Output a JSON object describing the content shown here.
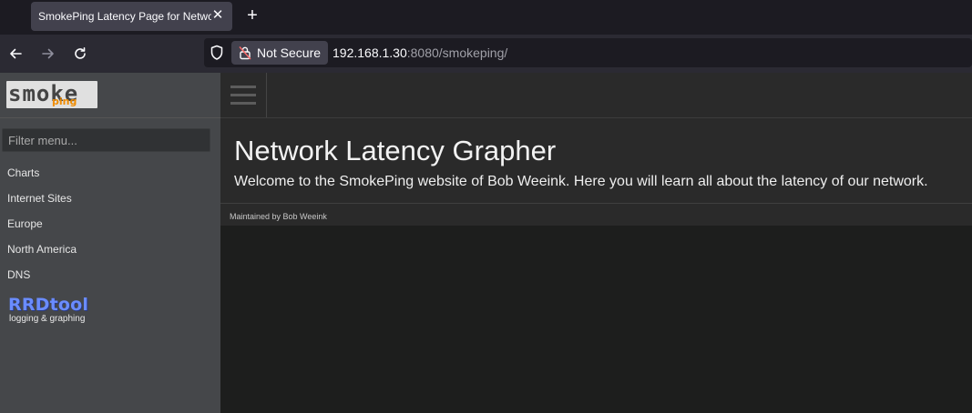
{
  "browser": {
    "tab_title": "SmokePing Latency Page for Network Latency Grapher",
    "tab_close": "✕",
    "new_tab": "+",
    "security_label": "Not Secure",
    "url_host": "192.168.1.30",
    "url_rest": ":8080/smokeping/"
  },
  "sidebar": {
    "logo_main": "smoke",
    "logo_sub": "ping",
    "filter_placeholder": "Filter menu...",
    "items": [
      {
        "label": "Charts"
      },
      {
        "label": "Internet Sites"
      },
      {
        "label": "Europe"
      },
      {
        "label": "North America"
      },
      {
        "label": "DNS"
      }
    ],
    "rrd_logo": "RRDtool",
    "rrd_tagline": "logging & graphing"
  },
  "main": {
    "title": "Network Latency Grapher",
    "welcome": "Welcome to the SmokePing website of Bob Weeink. Here you will learn all about the latency of our network.",
    "maintainer": "Maintained by Bob Weeink"
  },
  "icons": [
    "back-arrow-icon",
    "forward-arrow-icon",
    "reload-icon",
    "shield-icon",
    "lock-warning-icon",
    "hamburger-menu-icon"
  ]
}
